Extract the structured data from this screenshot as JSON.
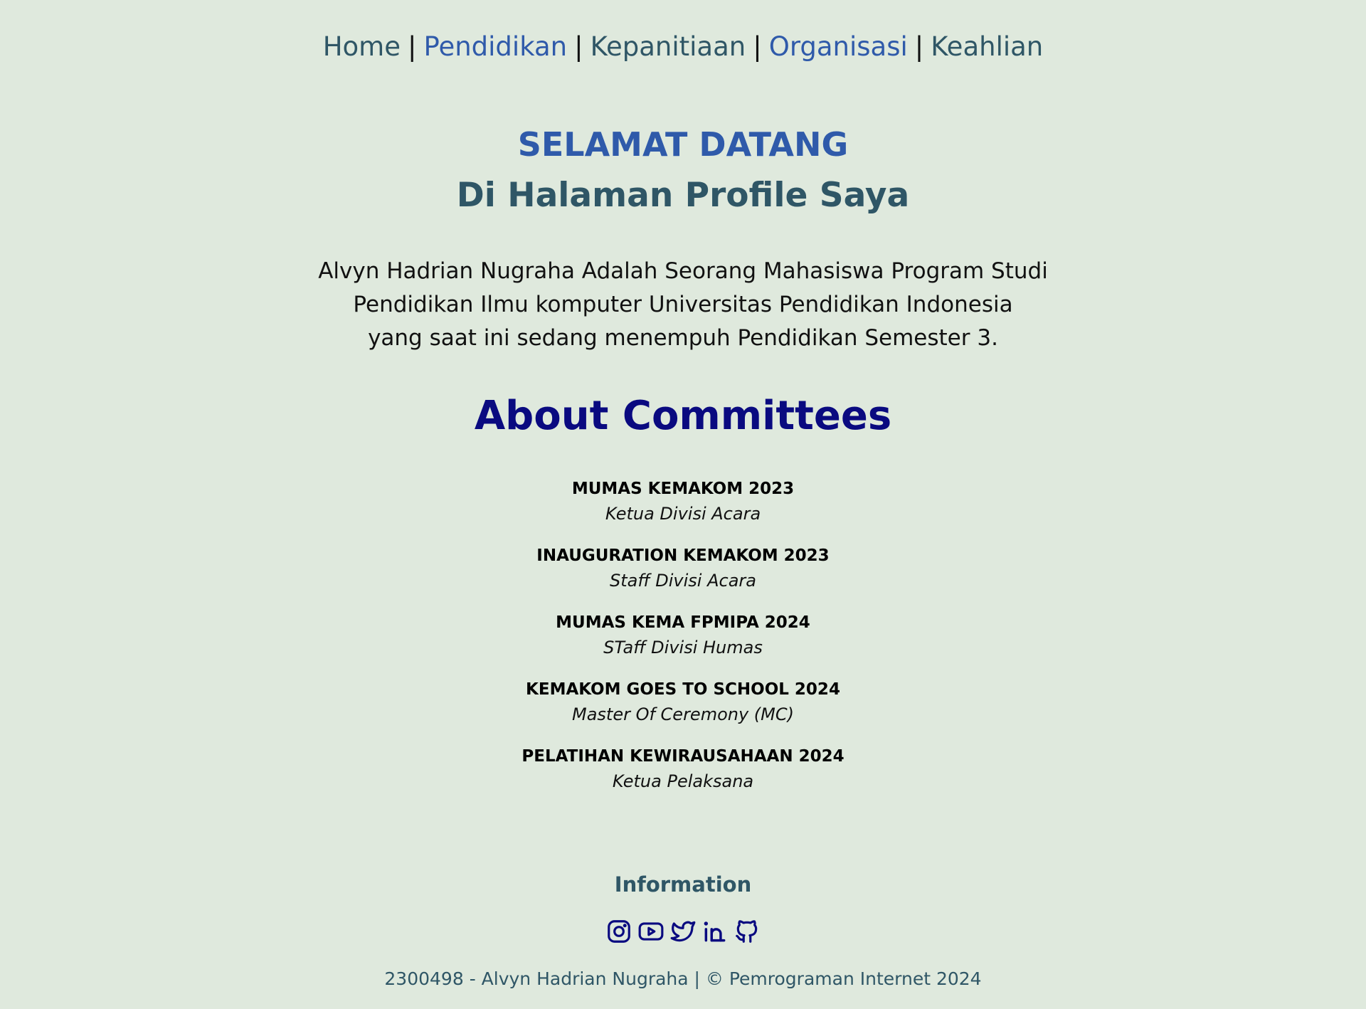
{
  "nav": {
    "items": [
      {
        "label": "Home"
      },
      {
        "label": "Pendidikan"
      },
      {
        "label": "Kepanitiaan"
      },
      {
        "label": "Organisasi"
      },
      {
        "label": "Keahlian"
      }
    ],
    "separator": "|"
  },
  "header": {
    "welcome": "SELAMAT DATANG",
    "subtitle": "Di Halaman Profile Saya"
  },
  "intro": {
    "line1": "Alvyn Hadrian Nugraha Adalah Seorang Mahasiswa Program Studi",
    "line2": "Pendidikan Ilmu komputer Universitas Pendidikan Indonesia",
    "line3": "yang saat ini sedang menempuh Pendidikan Semester 3."
  },
  "about": {
    "title": "About Committees",
    "items": [
      {
        "name": "MUMAS KEMAKOM 2023",
        "role": "Ketua Divisi Acara"
      },
      {
        "name": "INAUGURATION KEMAKOM 2023",
        "role": "Staff Divisi Acara"
      },
      {
        "name": "MUMAS KEMA FPMIPA 2024",
        "role": "STaff Divisi Humas"
      },
      {
        "name": "KEMAKOM GOES TO SCHOOL 2024",
        "role": "Master Of Ceremony (MC)"
      },
      {
        "name": "PELATIHAN KEWIRAUSAHAAN 2024",
        "role": "Ketua Pelaksana"
      }
    ]
  },
  "footer": {
    "title": "Information",
    "socials": [
      "instagram-icon",
      "youtube-icon",
      "twitter-icon",
      "linkedin-icon",
      "github-icon"
    ],
    "copyright": "2300498 - Alvyn Hadrian Nugraha | © Pemrograman Internet 2024"
  },
  "colors": {
    "background": "#dfe9dd",
    "nav_teal": "#2f5666",
    "nav_blue": "#2f5aaa",
    "about_title": "#0a0a80",
    "icon": "#0a0a80"
  }
}
